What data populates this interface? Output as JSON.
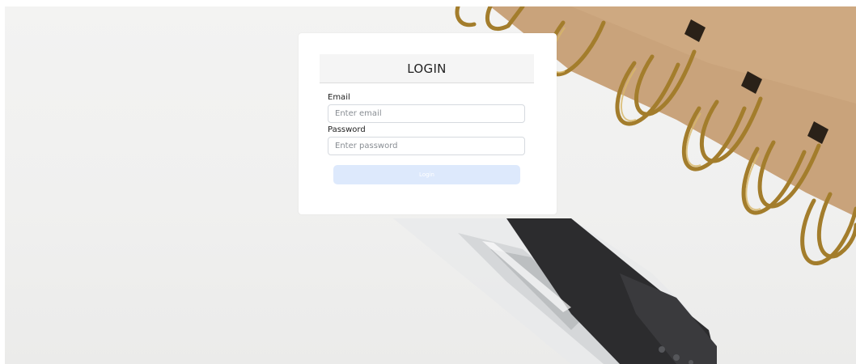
{
  "login_card": {
    "title": "LOGIN",
    "email_label": "Email",
    "email_placeholder": "Enter email",
    "email_value": "",
    "password_label": "Password",
    "password_placeholder": "Enter password",
    "password_value": "",
    "submit_label": "Login"
  },
  "colors": {
    "button_disabled_bg": "#dde9fc",
    "header_bg": "#f5f5f5",
    "page_bg": "#f0f0ef"
  },
  "background_image": {
    "subject": "spiral-bound kraft notebook with gold rings and a clear pen"
  }
}
